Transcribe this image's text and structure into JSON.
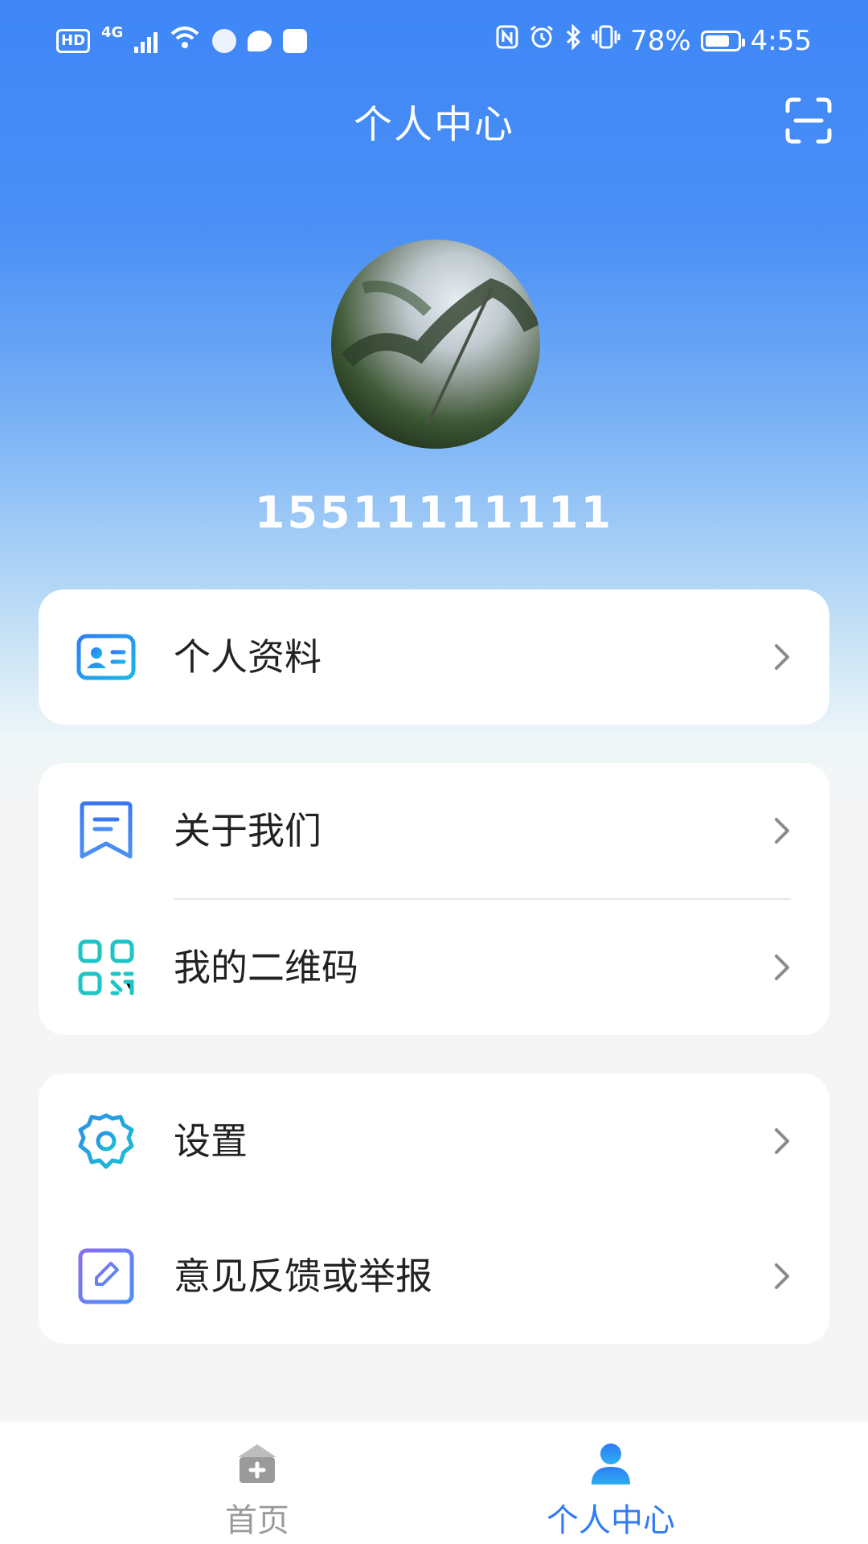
{
  "status_bar": {
    "hd": "HD",
    "network": "4G",
    "wifi": "6",
    "battery_percent": "78%",
    "time": "4:55",
    "battery_level": 0.78
  },
  "header": {
    "title": "个人中心",
    "scan_icon": "scan-icon"
  },
  "profile": {
    "username": "15511111111"
  },
  "menu_groups": [
    {
      "items": [
        {
          "label": "个人资料",
          "icon": "id-card-icon",
          "color": "#2f7cf6"
        }
      ]
    },
    {
      "items": [
        {
          "label": "关于我们",
          "icon": "bookmark-icon",
          "color": "#2f7cf6"
        },
        {
          "label": "我的二维码",
          "icon": "qr-code-icon",
          "color": "#1fc4c4"
        }
      ]
    },
    {
      "items": [
        {
          "label": "设置",
          "icon": "gear-icon",
          "color": "#1aa7e0"
        },
        {
          "label": "意见反馈或举报",
          "icon": "edit-icon",
          "color": "#6a7cf0"
        }
      ]
    }
  ],
  "bottom_nav": {
    "items": [
      {
        "label": "首页",
        "icon": "home-icon",
        "active": false
      },
      {
        "label": "个人中心",
        "icon": "person-icon",
        "active": true
      }
    ],
    "active_color": "#2f7cf6",
    "inactive_color": "#9a9a9a"
  }
}
